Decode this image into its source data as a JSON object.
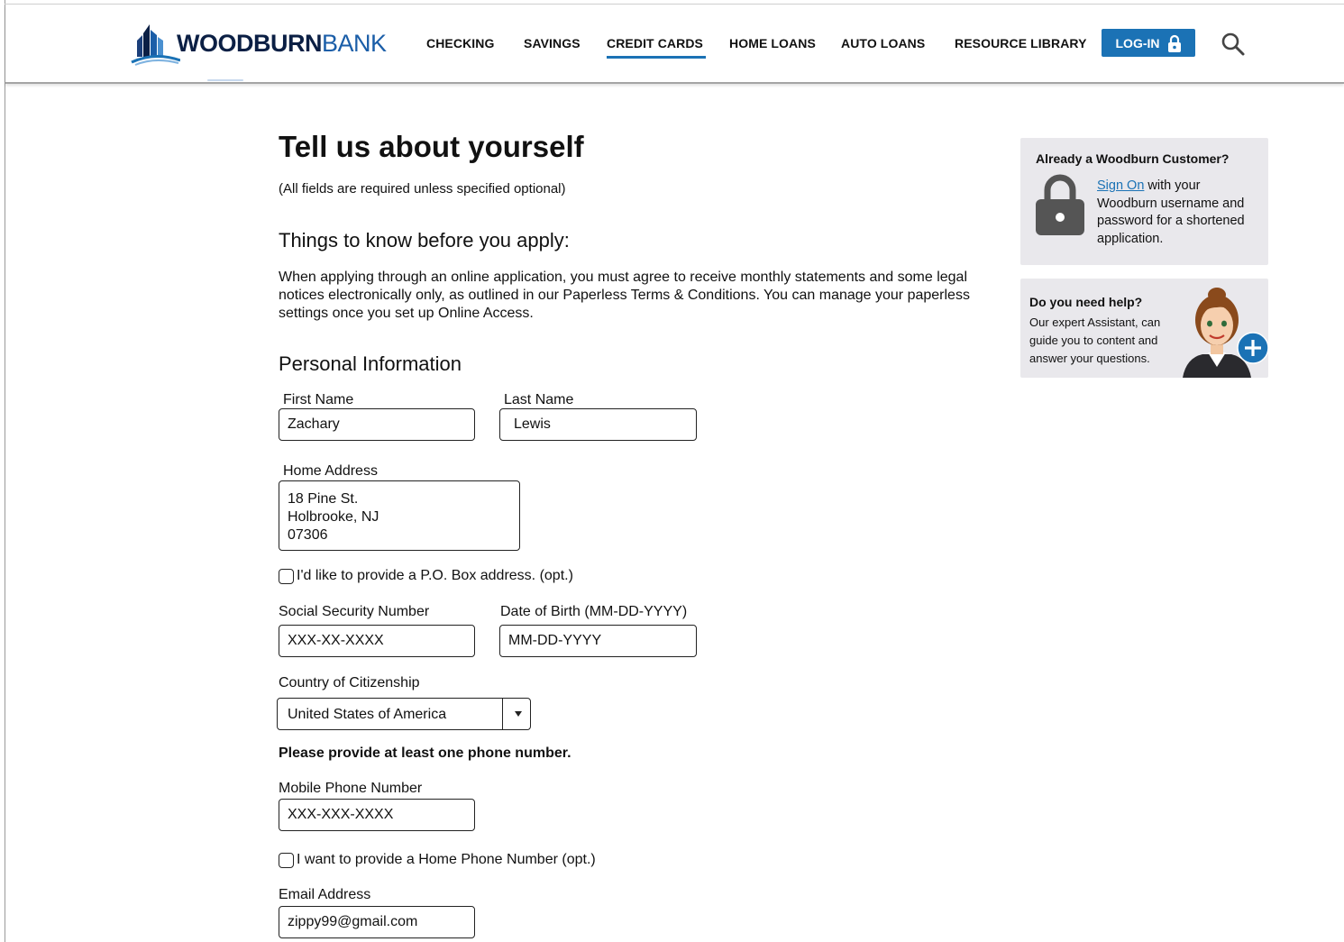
{
  "brand": {
    "name_bold": "WOODBURN",
    "name_light": "BANK"
  },
  "nav": {
    "items": [
      "CHECKING",
      "SAVINGS",
      "CREDIT CARDS",
      "HOME LOANS",
      "AUTO LOANS",
      "RESOURCE LIBRARY"
    ],
    "active": "CREDIT CARDS",
    "login_label": "LOG-IN",
    "accent_color": "#1b72b5"
  },
  "page": {
    "title": "Tell us about yourself",
    "required_note": "(All fields are required unless specified optional)",
    "things_heading": "Things to know before you apply:",
    "things_text": "When applying through an online application, you must agree to receive monthly statements and some legal notices electronically only, as outlined in our Paperless Terms & Conditions. You can manage your paperless settings once you set up Online Access.",
    "personal_heading": "Personal Information"
  },
  "form": {
    "first_name": {
      "label": "First Name",
      "value": "Zachary"
    },
    "last_name": {
      "label": "Last Name",
      "value": "Lewis"
    },
    "home_address": {
      "label": "Home Address",
      "value": "18 Pine St.\nHolbrooke, NJ\n07306"
    },
    "po_box_checkbox": {
      "label": "I'd like to provide a P.O. Box address. (opt.)",
      "checked": false
    },
    "ssn": {
      "label": "Social Security Number",
      "value": "XXX-XX-XXXX"
    },
    "dob": {
      "label": "Date of Birth (MM-DD-YYYY)",
      "value": "MM-DD-YYYY"
    },
    "citizenship": {
      "label": "Country of Citizenship",
      "selected": "United States of America"
    },
    "phone_note": "Please provide at least one phone number.",
    "mobile_phone": {
      "label": "Mobile Phone Number",
      "value": "XXX-XXX-XXXX"
    },
    "home_phone_checkbox": {
      "label": "I want to provide a Home Phone Number (opt.)",
      "checked": false
    },
    "email": {
      "label": "Email Address",
      "value": "zippy99@gmail.com"
    }
  },
  "sidebar": {
    "customer_card": {
      "title": "Already a Woodburn Customer?",
      "link_text": "Sign On",
      "body_after_link": " with your Woodburn username and password for a shortened application."
    },
    "help_card": {
      "title": "Do you need help?",
      "body": "Our expert Assistant, can guide you to content and answer your questions."
    }
  },
  "icons": [
    "bank-logo-icon",
    "lock-icon",
    "search-icon",
    "lock-large-icon",
    "assistant-avatar-icon",
    "plus-icon",
    "chevron-down-icon"
  ]
}
